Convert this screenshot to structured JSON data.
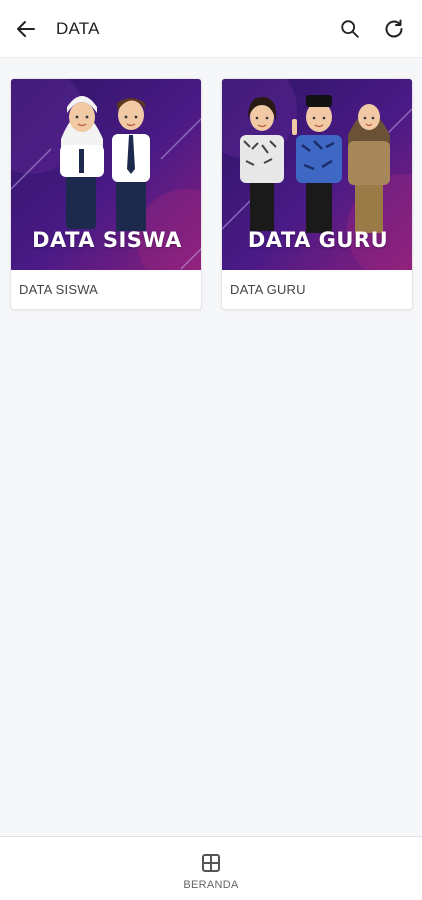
{
  "header": {
    "title": "DATA",
    "back_icon": "arrow-left-icon",
    "search_icon": "search-icon",
    "refresh_icon": "refresh-icon"
  },
  "menu": {
    "items": [
      {
        "image_caption": "DATA SISWA",
        "label": "DATA SISWA",
        "image": "students-illustration"
      },
      {
        "image_caption": "DATA GURU",
        "label": "DATA GURU",
        "image": "teachers-illustration"
      }
    ]
  },
  "bottom_nav": {
    "items": [
      {
        "label": "BERANDA",
        "icon": "grid-icon"
      }
    ]
  },
  "colors": {
    "banner_dark": "#2e1566",
    "banner_mid": "#5a1d8c",
    "banner_accent": "#8a1f7c"
  }
}
